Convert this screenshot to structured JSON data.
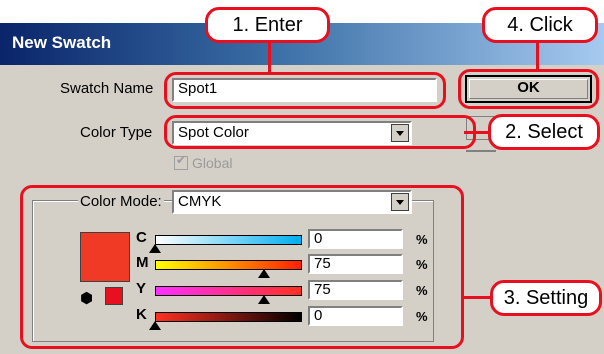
{
  "dialog": {
    "title": "New Swatch",
    "swatch_name_label": "Swatch Name",
    "swatch_name_value": "Spot1",
    "color_type_label": "Color Type",
    "color_type_value": "Spot Color",
    "global_label": "Global",
    "color_mode_label": "Color Mode:",
    "color_mode_value": "CMYK",
    "ok_label": "OK",
    "swatch_color": "#f03a26"
  },
  "channels": [
    {
      "label": "C",
      "value": "0",
      "unit": "%",
      "gradient": [
        "#ffffff",
        "#00aeef"
      ]
    },
    {
      "label": "M",
      "value": "75",
      "unit": "%",
      "gradient": [
        "#ffff00",
        "#ff2000"
      ]
    },
    {
      "label": "Y",
      "value": "75",
      "unit": "%",
      "gradient": [
        "#ff30ff",
        "#ff3020"
      ]
    },
    {
      "label": "K",
      "value": "0",
      "unit": "%",
      "gradient": [
        "#ff3020",
        "#000000"
      ]
    }
  ],
  "callouts": {
    "enter": "1. Enter",
    "select": "2. Select",
    "setting": "3. Setting",
    "click": "4. Click"
  },
  "colors": {
    "accent": "#e8101e",
    "dialog_bg": "#d4d0c8"
  }
}
